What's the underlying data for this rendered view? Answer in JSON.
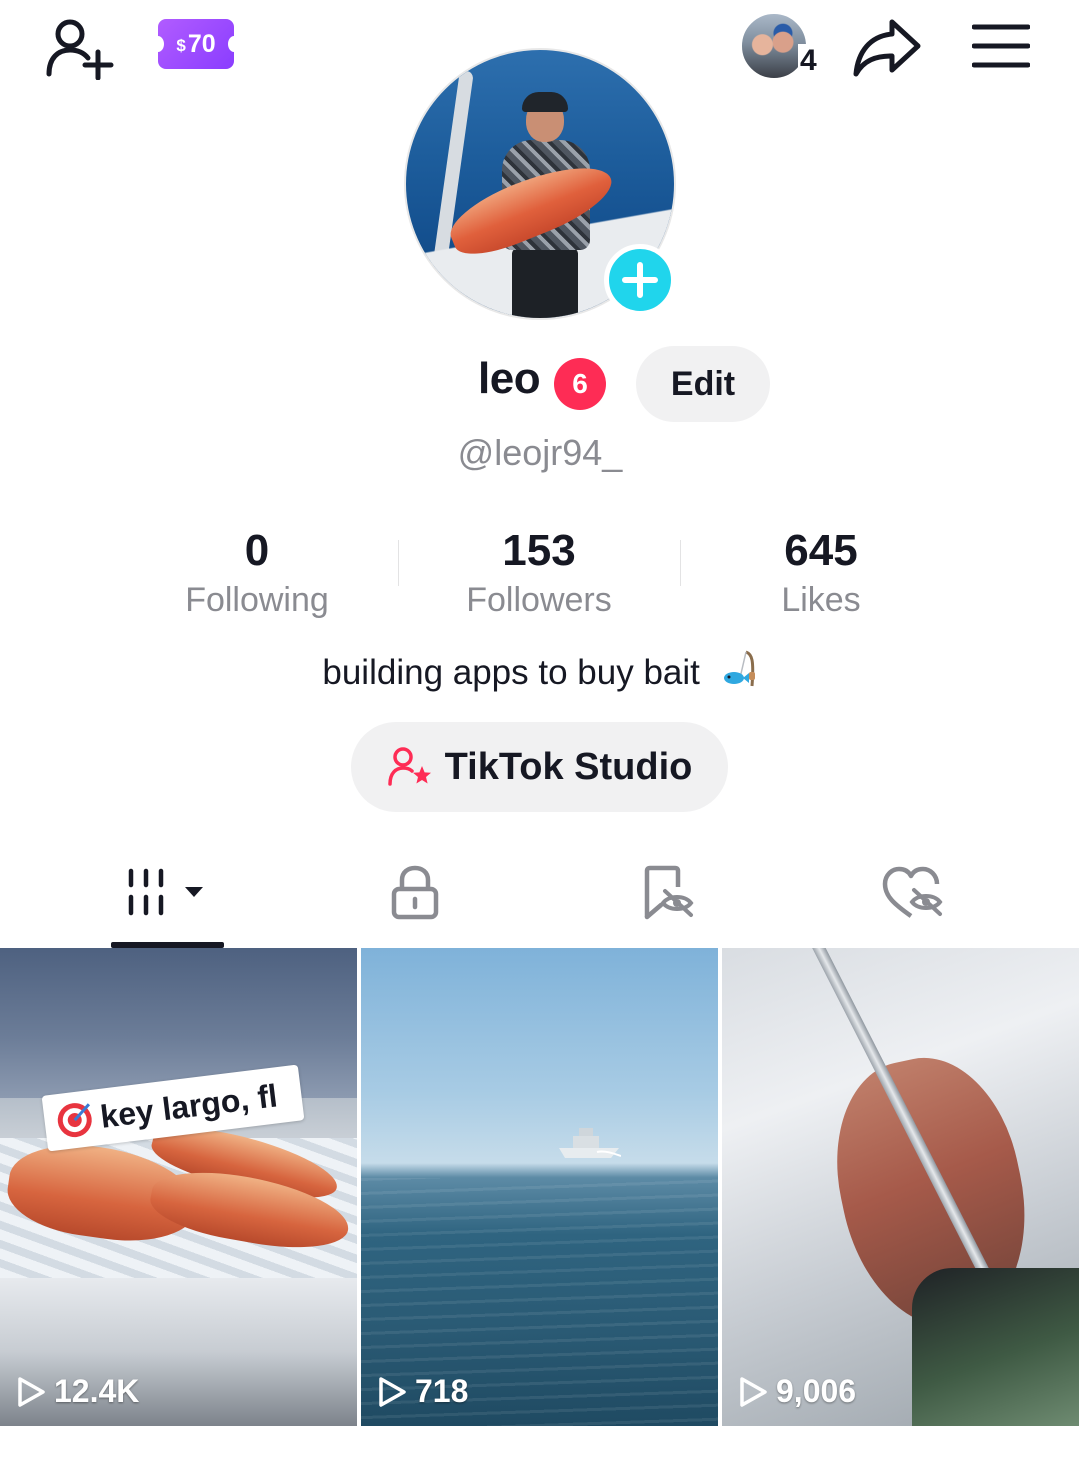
{
  "topbar": {
    "coin_amount": "70",
    "coin_currency": "$",
    "viewer_count": "4",
    "icons": [
      "add-friend-icon",
      "share-icon",
      "menu-icon"
    ]
  },
  "profile": {
    "name": "leo",
    "notification_count": "6",
    "edit_label": "Edit",
    "handle": "@leojr94_",
    "bio": "building apps to buy bait"
  },
  "stats": [
    {
      "value": "0",
      "label": "Following"
    },
    {
      "value": "153",
      "label": "Followers"
    },
    {
      "value": "645",
      "label": "Likes"
    }
  ],
  "studio": {
    "label": "TikTok Studio"
  },
  "tabs": [
    {
      "name": "videos",
      "icon": "grid-videos-icon",
      "selected": true
    },
    {
      "name": "private",
      "icon": "lock-icon",
      "selected": false
    },
    {
      "name": "saved",
      "icon": "bookmark-hidden-icon",
      "selected": false
    },
    {
      "name": "liked",
      "icon": "heart-hidden-icon",
      "selected": false
    }
  ],
  "videos": [
    {
      "views": "12.4K",
      "sticker": "key largo, fl"
    },
    {
      "views": "718"
    },
    {
      "views": "9,006"
    }
  ],
  "colors": {
    "accent": "#fe2c55",
    "add_photo": "#20d5ec",
    "coin": "#9b48ff",
    "secondary_text": "#8a8b91",
    "button_bg": "#f1f1f2"
  }
}
